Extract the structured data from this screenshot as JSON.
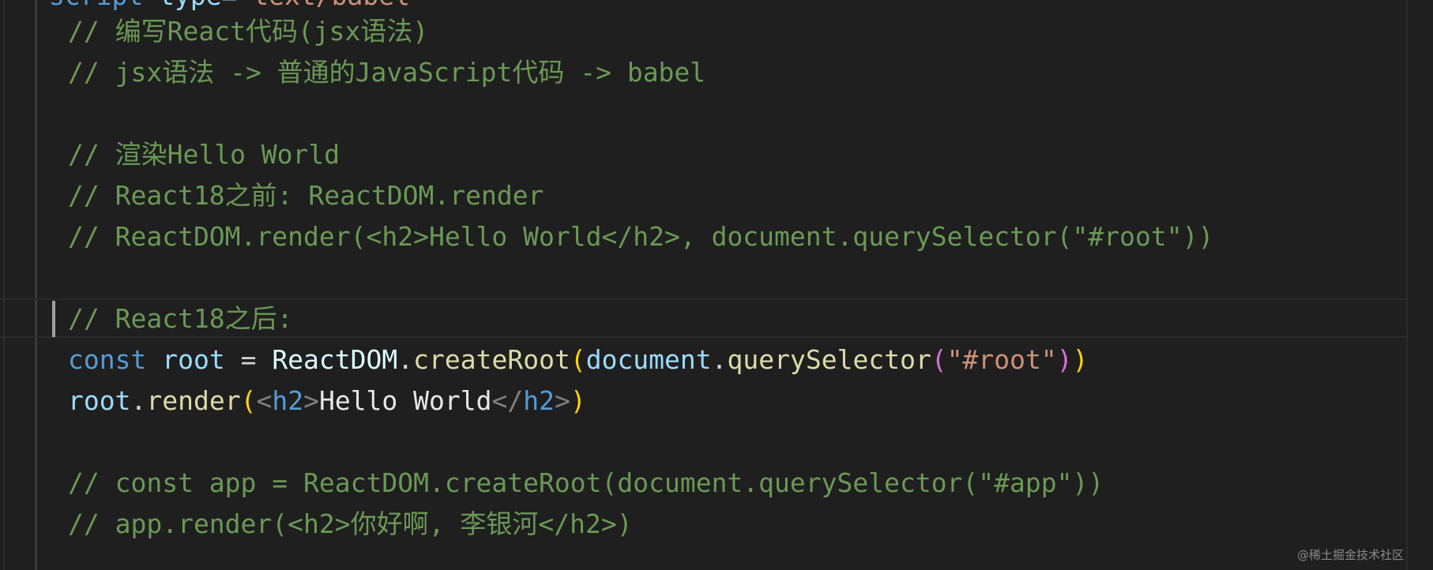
{
  "editor": {
    "top_partial": {
      "keyword": "script",
      "attr": " type=",
      "value": "\"text/babel\""
    },
    "lines": {
      "l1": "// 编写React代码(jsx语法)",
      "l2": "// jsx语法 -> 普通的JavaScript代码 -> babel",
      "l3": "// 渲染Hello World",
      "l4": "// React18之前: ReactDOM.render",
      "l5": "// ReactDOM.render(<h2>Hello World</h2>, document.querySelector(\"#root\"))",
      "l6": "// React18之后:",
      "l7": {
        "const": "const",
        "root": "root",
        "eq": " = ",
        "reactdom": "ReactDOM",
        "dot1": ".",
        "createRoot": "createRoot",
        "paren_open": "(",
        "document": "document",
        "dot2": ".",
        "querySelector": "querySelector",
        "paren2_open": "(",
        "string": "\"#root\"",
        "paren2_close": ")",
        "paren_close": ")"
      },
      "l8": {
        "root": "root",
        "dot": ".",
        "render": "render",
        "paren_open": "(",
        "lt": "<",
        "tag_open": "h2",
        "gt": ">",
        "text": "Hello World",
        "lt_slash": "</",
        "tag_close": "h2",
        "gt2": ">",
        "paren_close": ")"
      },
      "l9": "// const app = ReactDOM.createRoot(document.querySelector(\"#app\"))",
      "l10": "// app.render(<h2>你好啊, 李银河</h2>)"
    }
  },
  "watermark": "@稀土掘金技术社区"
}
